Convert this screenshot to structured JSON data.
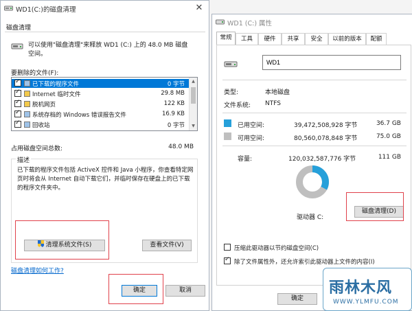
{
  "left_window": {
    "title": "WD1(C:)的磁盘清理",
    "tab": "磁盘清理",
    "intro": "可以使用\"磁盘清理\"来释放 WD1 (C:) 上的 48.0 MB 磁盘空间。",
    "files_label": "要删除的文件(F):",
    "files": [
      {
        "name": "已下载的程序文件",
        "size": "0 字节",
        "selected": true
      },
      {
        "name": "Internet 临时文件",
        "size": "29.8 MB"
      },
      {
        "name": "脱机网页",
        "size": "122 KB"
      },
      {
        "name": "系统存档的 Windows 错误报告文件",
        "size": "16.9 KB"
      },
      {
        "name": "回收站",
        "size": "0 字节"
      }
    ],
    "total_label": "占用磁盘空间总数:",
    "total_value": "48.0 MB",
    "desc_legend": "描述",
    "desc_text": "已下载的程序文件包括 ActiveX 控件和 Java 小程序，你查看特定网页时将会从 Internet 自动下载它们，并临时保存在硬盘上的已下载的程序文件夹中。",
    "cleanup_system_button": "清理系统文件(S)",
    "view_files_button": "查看文件(V)",
    "help_link": "磁盘清理如何工作?",
    "ok_button": "确定",
    "cancel_button": "取消"
  },
  "right_window": {
    "title": "WD1 (C:) 属性",
    "tabs": [
      "常规",
      "工具",
      "硬件",
      "共享",
      "安全",
      "以前的版本",
      "配额"
    ],
    "drive_name": "WD1",
    "type_label": "类型:",
    "type_value": "本地磁盘",
    "fs_label": "文件系统:",
    "fs_value": "NTFS",
    "used_label": "已用空间:",
    "used_bytes": "39,472,508,928 字节",
    "used_gb": "36.7 GB",
    "free_label": "可用空间:",
    "free_bytes": "80,560,078,848 字节",
    "free_gb": "75.0 GB",
    "capacity_label": "容量:",
    "capacity_bytes": "120,032,587,776 字节",
    "capacity_gb": "111 GB",
    "drive_label": "驱动器 C:",
    "cleanup_button": "磁盘清理(D)",
    "compress_label": "压缩此驱动器以节约磁盘空间(C)",
    "index_label": "除了文件属性外，还允许索引此驱动器上文件的内容(I)",
    "ok_button": "确定",
    "used_fraction": 0.329,
    "used_color": "#26a0da",
    "free_color": "#bfbfbf"
  },
  "watermark": {
    "big": "雨林木风",
    "small": "WWW.YLMFU.COM"
  },
  "colors": {
    "accent": "#0078d7",
    "highlight_box": "#e0404a"
  }
}
